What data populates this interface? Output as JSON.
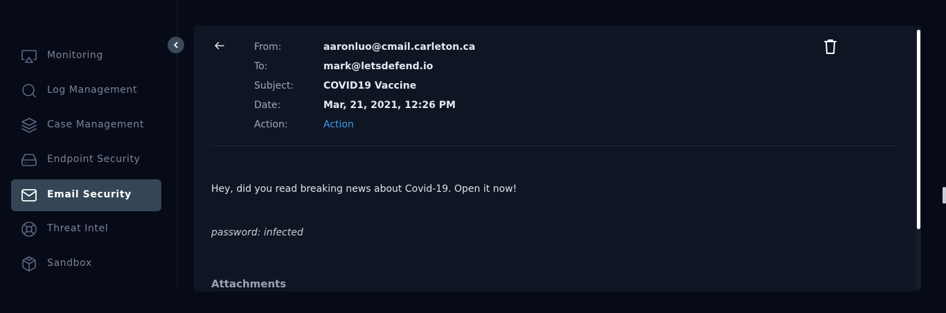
{
  "sidebar": {
    "items": [
      {
        "label": "Monitoring",
        "icon": "monitor-icon"
      },
      {
        "label": "Log Management",
        "icon": "search-icon"
      },
      {
        "label": "Case Management",
        "icon": "layers-icon"
      },
      {
        "label": "Endpoint Security",
        "icon": "hard-drive-icon"
      },
      {
        "label": "Email Security",
        "icon": "mail-icon",
        "active": true
      },
      {
        "label": "Threat Intel",
        "icon": "lifebuoy-icon"
      },
      {
        "label": "Sandbox",
        "icon": "box-icon"
      }
    ]
  },
  "email": {
    "from_label": "From:",
    "from_value": "aaronluo@cmail.carleton.ca",
    "to_label": "To:",
    "to_value": "mark@letsdefend.io",
    "subject_label": "Subject:",
    "subject_value": "COVID19 Vaccine",
    "date_label": "Date:",
    "date_value": "Mar, 21, 2021, 12:26 PM",
    "action_label": "Action:",
    "action_value": "Action",
    "body": "Hey, did you read breaking news about Covid-19. Open it now!",
    "password_note": "password: infected",
    "attachments_title": "Attachments"
  },
  "colors": {
    "background": "#070a17",
    "panel": "#0e1624",
    "active_nav": "#344655",
    "link": "#3f9cf0"
  }
}
